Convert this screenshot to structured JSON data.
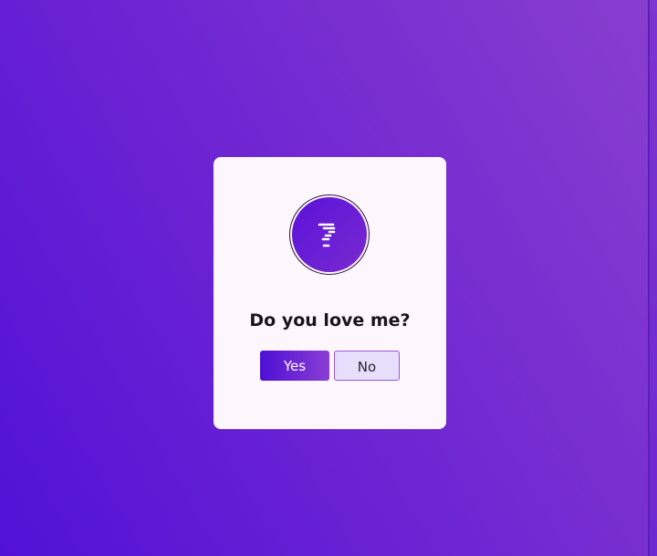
{
  "dialog": {
    "icon": "question-mark-icon",
    "question": "Do you love me?",
    "yes_label": "Yes",
    "no_label": "No"
  },
  "colors": {
    "background_start": "#5211d6",
    "background_end": "#8a3ecf",
    "card": "#fdf6fd",
    "accent": "#5a12d8",
    "no_button_bg": "#e6defa"
  }
}
